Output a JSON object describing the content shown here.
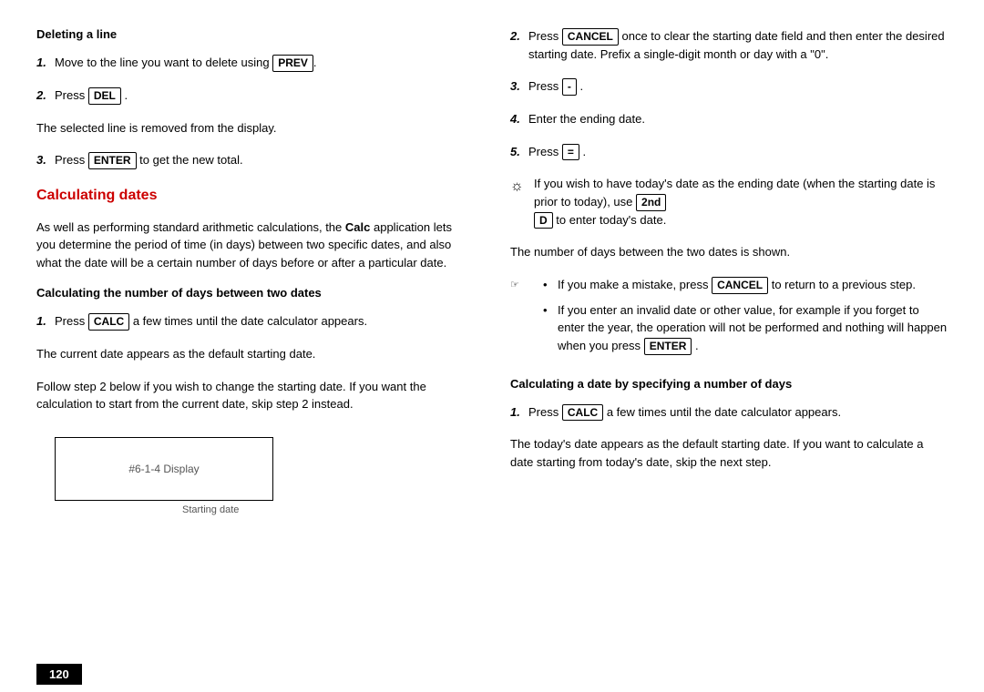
{
  "page": {
    "number": "120",
    "left": {
      "deleting_heading": "Deleting a line",
      "step1_text": "Move to the line you want to delete using",
      "step1_key": "PREV",
      "step2_text": "Press",
      "step2_key": "DEL",
      "step2_end": ".",
      "after_del": "The selected line is removed from the display.",
      "step3_text": "Press",
      "step3_key": "ENTER",
      "step3_end": "to get the new total.",
      "calc_dates_heading": "Calculating dates",
      "calc_dates_p1": "As well as performing standard arithmetic calculations, the",
      "calc_dates_p1b": "Calc",
      "calc_dates_p1c": "application lets you determine the period of time (in days) between two specific dates, and also what the date will be a certain number of days before or after a particular date.",
      "sub_heading": "Calculating the number of days between two dates",
      "sub_step1_text": "Press",
      "sub_step1_key": "CALC",
      "sub_step1_end": "a few times until the date calculator appears.",
      "current_date_text": "The current date appears as the default starting date.",
      "follow_text": "Follow step 2 below if you wish to change the starting date. If you want the calculation to start from the current date, skip step 2 instead.",
      "display_label": "#6-1-4 Display",
      "display_caption": "Starting date"
    },
    "right": {
      "step2_text": "Press",
      "step2_key": "CANCEL",
      "step2_end": "once to clear the starting date field and then enter the desired starting date. Prefix a single-digit month or day with a \"0\".",
      "step3_text": "Press",
      "step3_key": "-",
      "step3_end": ".",
      "step4_text": "Enter the ending date.",
      "step5_text": "Press",
      "step5_key": "=",
      "step5_end": ".",
      "tip_text": "If you wish to have today's date as the ending date (when the starting date is prior to today), use",
      "tip_key1": "2nd",
      "tip_key2": "D",
      "tip_end": "to enter today's date.",
      "days_shown": "The number of days between the two dates is shown.",
      "bullet1_prefix": "If you make a mistake, press",
      "bullet1_key": "CANCEL",
      "bullet1_end": "to return to a previous step.",
      "bullet2": "If you enter an invalid date or other value, for example if you forget to enter the year, the operation will not be performed and nothing will happen when you press",
      "bullet2_key": "ENTER",
      "bullet2_end": ".",
      "second_heading": "Calculating a date by specifying a number of days",
      "s_step1_text": "Press",
      "s_step1_key": "CALC",
      "s_step1_end": "a few times until the date calculator appears.",
      "today_text": "The today's date appears as the default starting date. If you want to calculate a date starting from today's date, skip the next step."
    }
  }
}
